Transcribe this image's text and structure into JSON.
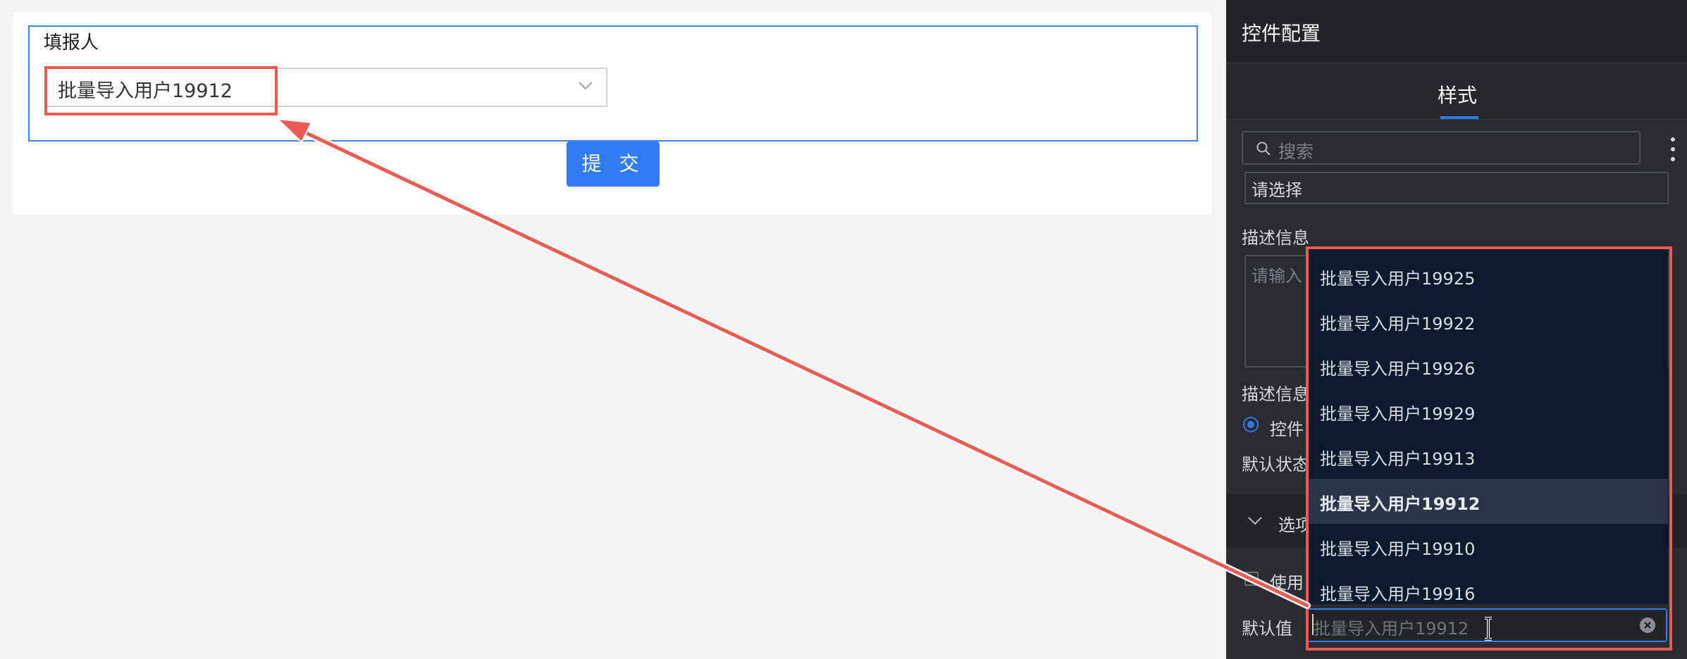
{
  "form": {
    "field_label": "填报人",
    "select_value": "批量导入用户19912",
    "submit_label": "提 交"
  },
  "panel": {
    "title": "控件配置",
    "tab_style": "样式",
    "search_placeholder": "搜索",
    "placeholder_value": "请选择",
    "desc_label": "描述信息",
    "desc_placeholder": "请输入",
    "desc_position_label": "描述信息",
    "radio_label": "控件",
    "default_state_label": "默认状态",
    "options_section": "选项",
    "use_label": "使用",
    "default_value_label": "默认值",
    "default_value_placeholder": "批量导入用户19912"
  },
  "dropdown": {
    "items": [
      {
        "label": "批量导入用户19925",
        "selected": false
      },
      {
        "label": "批量导入用户19922",
        "selected": false
      },
      {
        "label": "批量导入用户19926",
        "selected": false
      },
      {
        "label": "批量导入用户19929",
        "selected": false
      },
      {
        "label": "批量导入用户19913",
        "selected": false
      },
      {
        "label": "批量导入用户19912",
        "selected": true
      },
      {
        "label": "批量导入用户19910",
        "selected": false
      },
      {
        "label": "批量导入用户19916",
        "selected": false
      }
    ]
  },
  "colors": {
    "accent": "#2f7cf6",
    "highlight": "#ec5a52",
    "panel_bg": "#2a2c31",
    "dropdown_bg": "#0b1a2e"
  }
}
